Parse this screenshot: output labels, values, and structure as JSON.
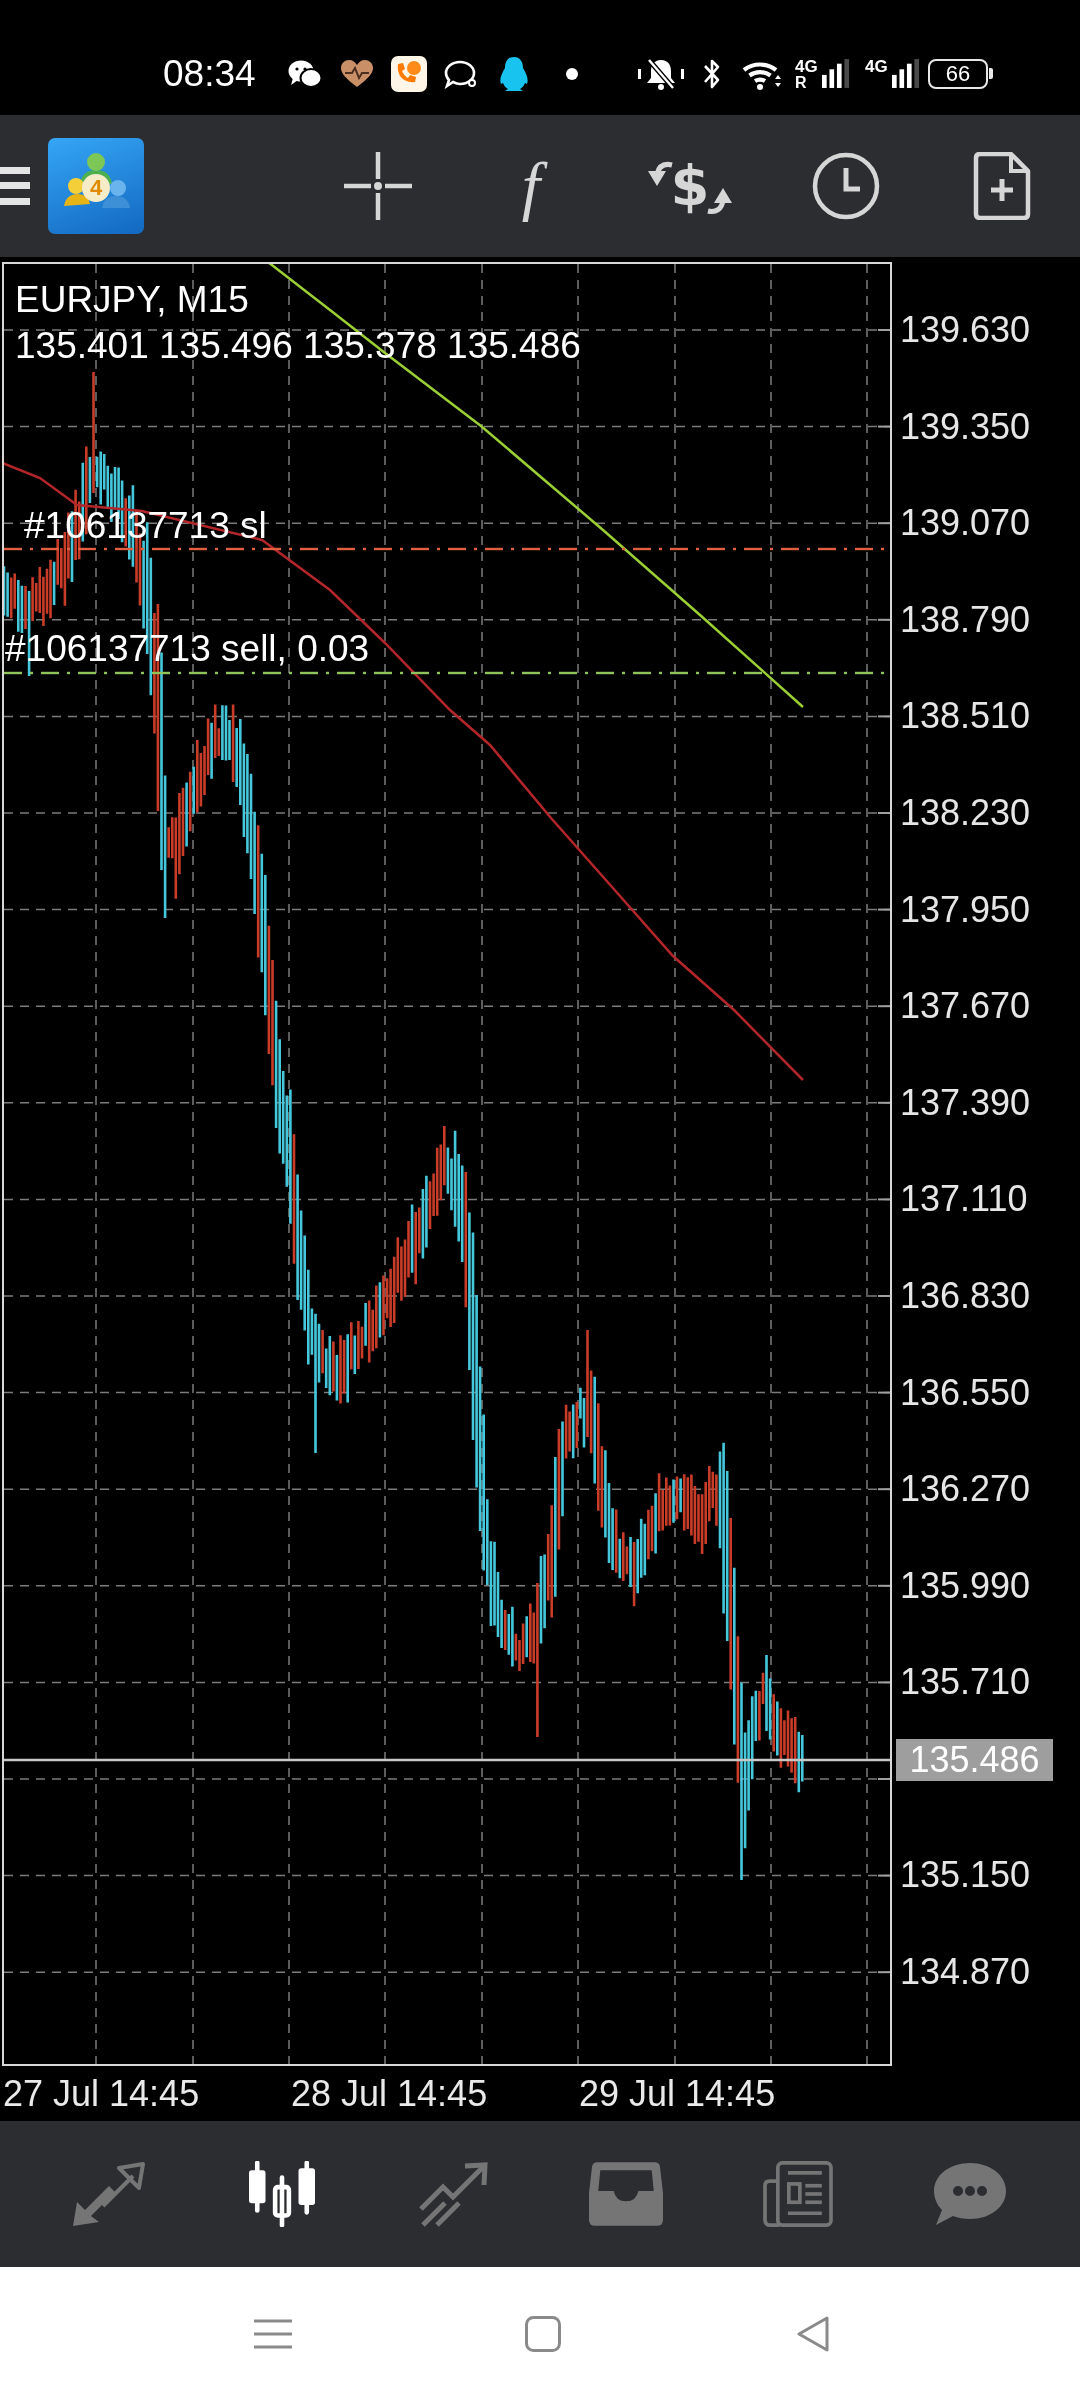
{
  "status_bar": {
    "time": "08:34",
    "signals": [
      {
        "network": "4G",
        "roaming": "R"
      },
      {
        "network": "4G"
      }
    ],
    "battery": "66"
  },
  "toolbar": {
    "logo_badge": "4",
    "function_symbol": "f",
    "trade_symbol": "$"
  },
  "chart": {
    "symbol": "EURJPY, M15",
    "ohlc": "135.401 135.496 135.378 135.486",
    "orders": [
      {
        "label": "#106137713 sl",
        "color": "#e0603f"
      },
      {
        "label": "#106137713 sell, 0.03",
        "color": "#8fc45a"
      }
    ],
    "price_axis": {
      "labels": [
        "139.630",
        "139.350",
        "139.070",
        "138.790",
        "138.510",
        "138.230",
        "137.950",
        "137.670",
        "137.390",
        "137.110",
        "136.830",
        "136.550",
        "136.270",
        "135.990",
        "135.710"
      ],
      "current_price": "135.486",
      "labels_below": [
        "135.150",
        "134.870"
      ]
    },
    "time_axis": {
      "labels": [
        "27 Jul 14:45",
        "28 Jul 14:45",
        "29 Jul 14:45"
      ]
    }
  },
  "bottom_nav": {
    "tabs": [
      {
        "kind": "quotes",
        "selected": false
      },
      {
        "kind": "chart",
        "selected": true
      },
      {
        "kind": "trade",
        "selected": false
      },
      {
        "kind": "history",
        "selected": false
      },
      {
        "kind": "news",
        "selected": false
      },
      {
        "kind": "chat",
        "selected": false
      }
    ]
  }
}
